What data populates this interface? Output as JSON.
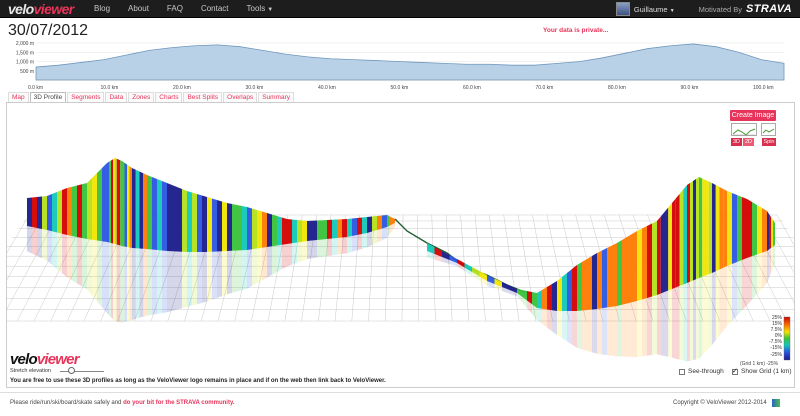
{
  "navbar": {
    "brand_main": "velo",
    "brand_accent": "viewer",
    "links": [
      "Blog",
      "About",
      "FAQ",
      "Contact",
      "Tools"
    ],
    "user": "Guillaume",
    "motivated_by": "Motivated By",
    "strava": "STRAVA"
  },
  "header": {
    "date": "30/07/2012",
    "private_msg": "Your data is private..."
  },
  "elevation": {
    "y_ticks": [
      "2,000 m",
      "1,500 m",
      "1,000 m",
      "500 m"
    ],
    "x_ticks": [
      "0.0 km",
      "10.0 km",
      "20.0 km",
      "30.0 km",
      "40.0 km",
      "50.0 km",
      "60.0 km",
      "70.0 km",
      "80.0 km",
      "90.0 km",
      "100.0 km"
    ],
    "profile_m": [
      700,
      800,
      950,
      1100,
      1350,
      1600,
      1750,
      1850,
      1900,
      1800,
      1600,
      1400,
      1250,
      1150,
      1100,
      1050,
      1000,
      950,
      900,
      850,
      850,
      800,
      800,
      900,
      1000,
      1200,
      1450,
      1700,
      1850,
      1950,
      1800,
      1500,
      1100,
      900
    ],
    "fill_color": "#b9d1e6",
    "line_color": "#6f97be"
  },
  "tabs": [
    "Map",
    "3D Profile",
    "Segments",
    "Data",
    "Zones",
    "Charts",
    "Best Splits",
    "Overlaps",
    "Summary"
  ],
  "active_tab": "3D Profile",
  "panel": {
    "create_image": "Create Image",
    "btn_3d": "3D",
    "btn_2d": "2D",
    "btn_spin": "Spin",
    "logo_main": "velo",
    "logo_accent": "viewer",
    "stretch_label": "Stretch elevation",
    "stretch_value": 0.2,
    "see_through": "See-through",
    "see_through_checked": false,
    "show_grid": "Show Grid (1 km)",
    "show_grid_checked": true,
    "legend_labels": [
      "25%",
      "15%",
      "7.5%",
      "0%",
      "-7.5%",
      "-15%",
      "-25%"
    ],
    "grid_note": "(Grid 1 km) -25%",
    "notice": "You are free to use these 3D profiles as long as the VeloViewer logo remains in place and if on the web then link back to VeloViewer.",
    "accent_color": "#e8345a"
  },
  "footer": {
    "left_text": "Please ride/run/ski/board/skate safely and",
    "left_link": "do your bit for the STRAVA community.",
    "copyright": "Copyright © VeloViewer 2012-2014"
  }
}
